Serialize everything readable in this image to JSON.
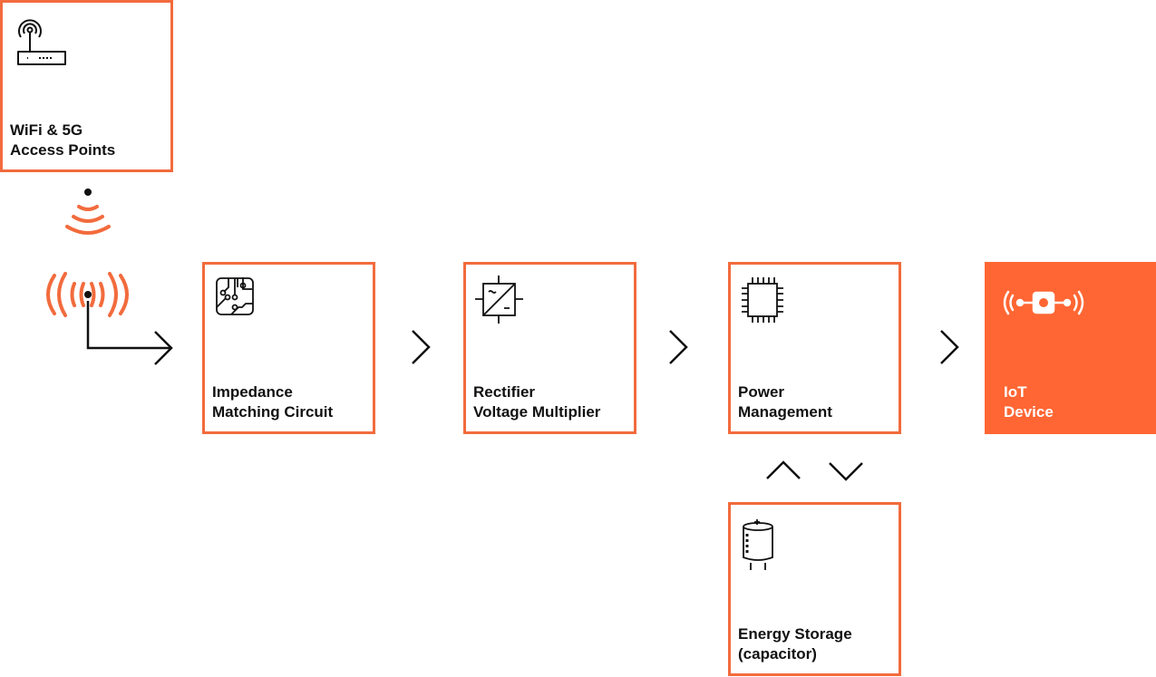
{
  "colors": {
    "accent": "#F26B3D",
    "iot_fill": "#FF6633",
    "stroke": "#111111"
  },
  "nodes": [
    {
      "id": "access-points",
      "icon": "router-antenna-icon",
      "lines": [
        "WiFi & 5G",
        "Access Points"
      ]
    },
    {
      "id": "impedance",
      "icon": "circuit-board-icon",
      "lines": [
        "Impedance",
        "Matching Circuit"
      ]
    },
    {
      "id": "rectifier",
      "icon": "ac-dc-converter-icon",
      "lines": [
        "Rectifier",
        "Voltage Multiplier"
      ]
    },
    {
      "id": "power",
      "icon": "chip-icon",
      "lines": [
        "Power",
        "Management"
      ]
    },
    {
      "id": "iot",
      "icon": "iot-device-icon",
      "lines": [
        "IoT",
        "Device"
      ]
    },
    {
      "id": "storage",
      "icon": "capacitor-icon",
      "lines": [
        "Energy Storage",
        "(capacitor)"
      ]
    }
  ]
}
